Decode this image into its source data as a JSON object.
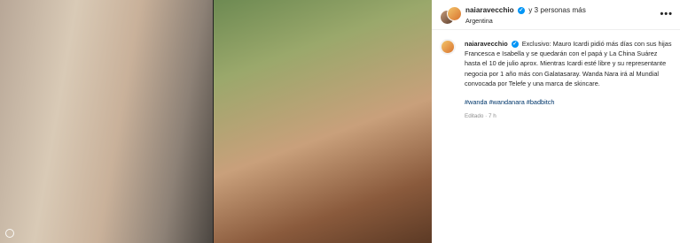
{
  "header": {
    "username": "naiaravecchio",
    "verified_glyph": "✓",
    "others": "y 3 personas más",
    "location": "Argentina",
    "menu_icon": "•••"
  },
  "caption": {
    "username": "naiaravecchio",
    "verified_glyph": "✓",
    "text": "Exclusivo: Mauro Icardi pidió más días con sus hijas Francesca e Isabella y se quedarán con el papá y La China Suárez hasta el 10 de julio aprox. Mientras Icardi esté libre y su representante negocia por 1 año más con Galatasaray. Wanda Nara irá al Mundial convocada por Telefe y una marca de skincare.",
    "hashtags": "#wanda #wandanara #badbitch",
    "edited": "Editado",
    "separator": "·",
    "time": "7 h"
  },
  "colors": {
    "verified": "#0095f6",
    "hashtag": "#00376b",
    "meta": "#8e8e8e"
  }
}
